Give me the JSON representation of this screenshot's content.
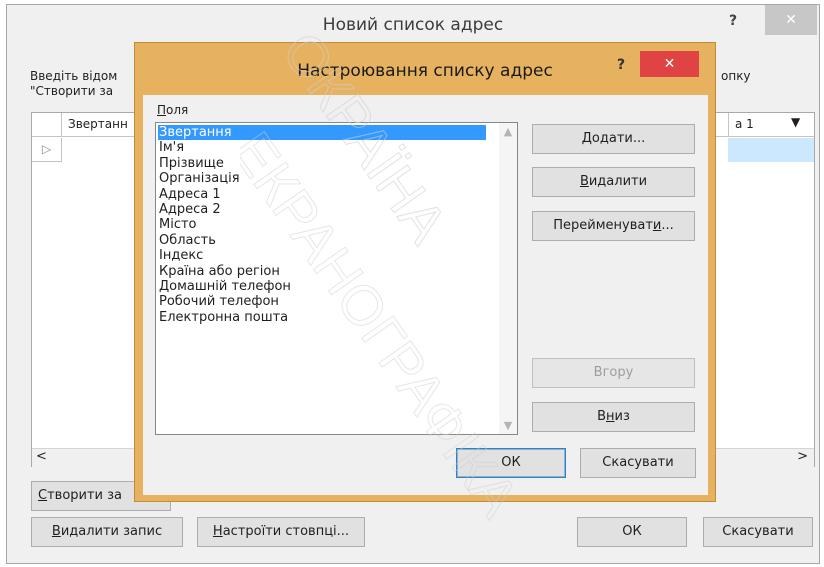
{
  "outer": {
    "title": "Новий список адрес",
    "help_label": "?",
    "close_label": "✕",
    "instruction": "Введіть відом\n\"Створити за",
    "instruction_right": "опку",
    "grid": {
      "col1_header": "Звертанн",
      "col_right_header": "а 1",
      "col_right_arrow": "▼",
      "row_indicator": "▷"
    },
    "hscroll": {
      "left": "<",
      "right": ">"
    },
    "buttons": {
      "create_entry_prefix": "С",
      "create_entry_rest": "творити за",
      "delete_entry_prefix": "В",
      "delete_entry_rest": "идалити запис",
      "customize_prefix": "Н",
      "customize_rest": "астроїти стовпці...",
      "ok": "ОК",
      "cancel": "Скасувати"
    }
  },
  "inner": {
    "title": "Настроювання списку адрес",
    "help_label": "?",
    "close_label": "✕",
    "fields_label_prefix": "П",
    "fields_label_rest": "оля",
    "fields": [
      "Звертання",
      "Ім'я",
      "Прізвище",
      "Організація",
      "Адреса 1",
      "Адреса 2",
      "Місто",
      "Область",
      "Індекс",
      "Країна або регіон",
      "Домашній телефон",
      "Робочий телефон",
      "Електронна пошта"
    ],
    "selected_index": 0,
    "buttons": {
      "add_prefix": "Д",
      "add_rest": "одати...",
      "delete_prefix": "В",
      "delete_rest": "идалити",
      "rename_pre": "Перейменуват",
      "rename_u": "и",
      "rename_post": "...",
      "up": "Вгору",
      "down_pre": "В",
      "down_u": "н",
      "down_post": "из",
      "ok": "ОК",
      "cancel": "Скасувати"
    }
  },
  "colors": {
    "inner_frame": "#e7b25f",
    "close_red": "#e04343",
    "selection": "#3399ff"
  },
  "watermark": {
    "text_a": "ОКРАЇНА",
    "text_b": "ЕКРАНОГРАФІКА"
  }
}
